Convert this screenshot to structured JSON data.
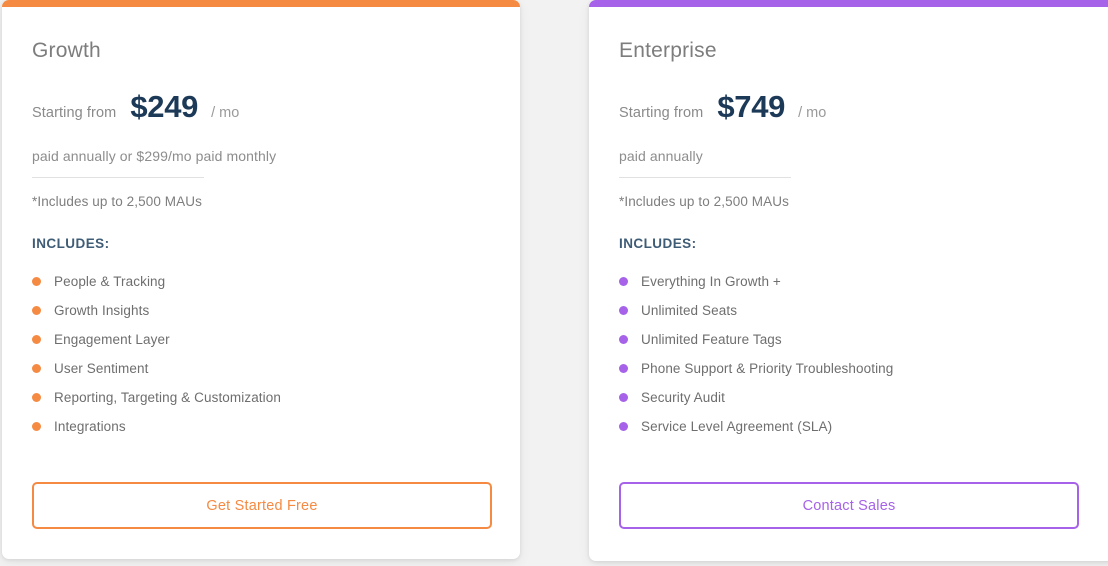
{
  "page": {
    "background_color": "#f2f2f2"
  },
  "plans": [
    {
      "id": "growth",
      "accent_color": "#F58A42",
      "bullet_color": "#F58A42",
      "title": "Growth",
      "price_prefix": "Starting from",
      "price_amount": "$249",
      "price_period": "/ mo",
      "billing_note": "paid annually or $299/mo paid monthly",
      "maus_note": "*Includes up to 2,500 MAUs",
      "includes_label": "INCLUDES:",
      "features": [
        "People & Tracking",
        "Growth Insights",
        "Engagement Layer",
        "User Sentiment",
        "Reporting, Targeting & Customization",
        "Integrations"
      ],
      "cta_label": "Get Started Free"
    },
    {
      "id": "enterprise",
      "accent_color": "#A662E8",
      "bullet_color": "#A662E8",
      "title": "Enterprise",
      "price_prefix": "Starting from",
      "price_amount": "$749",
      "price_period": "/ mo",
      "billing_note": "paid annually",
      "maus_note": "*Includes up to 2,500 MAUs",
      "includes_label": "INCLUDES:",
      "features": [
        "Everything In Growth +",
        "Unlimited Seats",
        "Unlimited Feature Tags",
        "Phone Support & Priority Troubleshooting",
        "Security Audit",
        "Service Level Agreement (SLA)"
      ],
      "cta_label": "Contact Sales"
    }
  ]
}
